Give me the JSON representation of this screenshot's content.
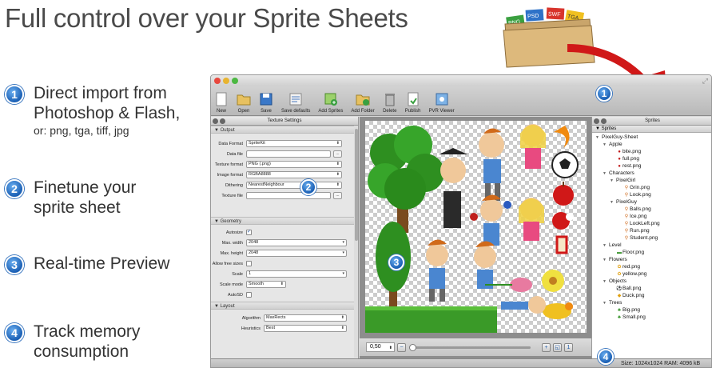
{
  "headline": "Full control over your Sprite Sheets",
  "folder_tags": [
    "PNG",
    "PSD",
    "SWF",
    "TGA"
  ],
  "features": [
    {
      "num": "1",
      "line1": "Direct import from",
      "line2": "Photoshop & Flash,",
      "sub": "or: png, tga, tiff, jpg"
    },
    {
      "num": "2",
      "line1": "Finetune your",
      "line2": "sprite sheet",
      "sub": ""
    },
    {
      "num": "3",
      "line1": "Real-time Preview",
      "line2": "",
      "sub": ""
    },
    {
      "num": "4",
      "line1": "Track memory",
      "line2": "consumption",
      "sub": ""
    }
  ],
  "toolbar": {
    "new": "New",
    "open": "Open",
    "save": "Save",
    "save_defaults": "Save defaults",
    "add_sprites": "Add Sprites",
    "add_folder": "Add Folder",
    "delete": "Delete",
    "publish": "Publish",
    "pvr_viewer": "PVR Viewer"
  },
  "texture_settings": {
    "title": "Texture Settings",
    "output": "Output",
    "data_format_label": "Data Format",
    "data_format": "SpriteKit",
    "data_file_label": "Data file",
    "data_file": "",
    "texture_format_label": "Texture format",
    "texture_format": "PNG (.png)",
    "image_format_label": "Image format",
    "image_format": "RGBA8888",
    "dithering_label": "Dithering",
    "dithering": "NearestNeighbour",
    "texture_file_label": "Texture file",
    "texture_file": "",
    "browse": "...",
    "geometry": "Geometry",
    "autosize_label": "Autosize",
    "max_width_label": "Max. width",
    "max_width": "2048",
    "max_height_label": "Max. height",
    "max_height": "2048",
    "allow_free_label": "Allow free sizes",
    "scale_label": "Scale",
    "scale": "1",
    "scale_mode_label": "Scale mode",
    "scale_mode": "Smooth",
    "autosd_label": "AutoSD",
    "layout": "Layout",
    "algorithm_label": "Algorithm",
    "algorithm": "MaxRects",
    "heuristics_label": "Heuristics",
    "heuristics": "Best"
  },
  "zoom": {
    "value": "0,50"
  },
  "sprites_panel": {
    "title": "Sprites",
    "header": "Sprites",
    "tree": [
      {
        "level": 0,
        "label": "PixelGuy-Sheet",
        "folder": true
      },
      {
        "level": 1,
        "label": "Apple",
        "folder": true
      },
      {
        "level": 2,
        "label": "bite.png",
        "icon": "apple-icon"
      },
      {
        "level": 2,
        "label": "full.png",
        "icon": "apple-icon"
      },
      {
        "level": 2,
        "label": "rest.png",
        "icon": "apple-icon"
      },
      {
        "level": 1,
        "label": "Characters",
        "folder": true
      },
      {
        "level": 2,
        "label": "PixelGirl",
        "folder": true
      },
      {
        "level": 3,
        "label": "Grin.png",
        "icon": "figure-icon"
      },
      {
        "level": 3,
        "label": "Look.png",
        "icon": "figure-icon"
      },
      {
        "level": 2,
        "label": "PixelGuy",
        "folder": true
      },
      {
        "level": 3,
        "label": "Balls.png",
        "icon": "figure-icon"
      },
      {
        "level": 3,
        "label": "Ice.png",
        "icon": "figure-icon"
      },
      {
        "level": 3,
        "label": "LookLeft.png",
        "icon": "figure-icon"
      },
      {
        "level": 3,
        "label": "Run.png",
        "icon": "figure-icon"
      },
      {
        "level": 3,
        "label": "Student.png",
        "icon": "figure-icon"
      },
      {
        "level": 1,
        "label": "Level",
        "folder": true
      },
      {
        "level": 2,
        "label": "Floor.png",
        "icon": "floor-icon"
      },
      {
        "level": 1,
        "label": "Flowers",
        "folder": true
      },
      {
        "level": 2,
        "label": "red.png",
        "icon": "flower-icon"
      },
      {
        "level": 2,
        "label": "yellow.png",
        "icon": "flower-icon"
      },
      {
        "level": 1,
        "label": "Objects",
        "folder": true
      },
      {
        "level": 2,
        "label": "Ball.png",
        "icon": "ball-icon"
      },
      {
        "level": 2,
        "label": "Duck.png",
        "icon": "duck-icon"
      },
      {
        "level": 1,
        "label": "Trees",
        "folder": true
      },
      {
        "level": 2,
        "label": "Big.png",
        "icon": "tree-icon"
      },
      {
        "level": 2,
        "label": "Small.png",
        "icon": "tree-icon"
      }
    ]
  },
  "status": "Size: 1024x1024 RAM: 4096 kB",
  "overlay_badges": [
    "1",
    "2",
    "3",
    "4"
  ]
}
